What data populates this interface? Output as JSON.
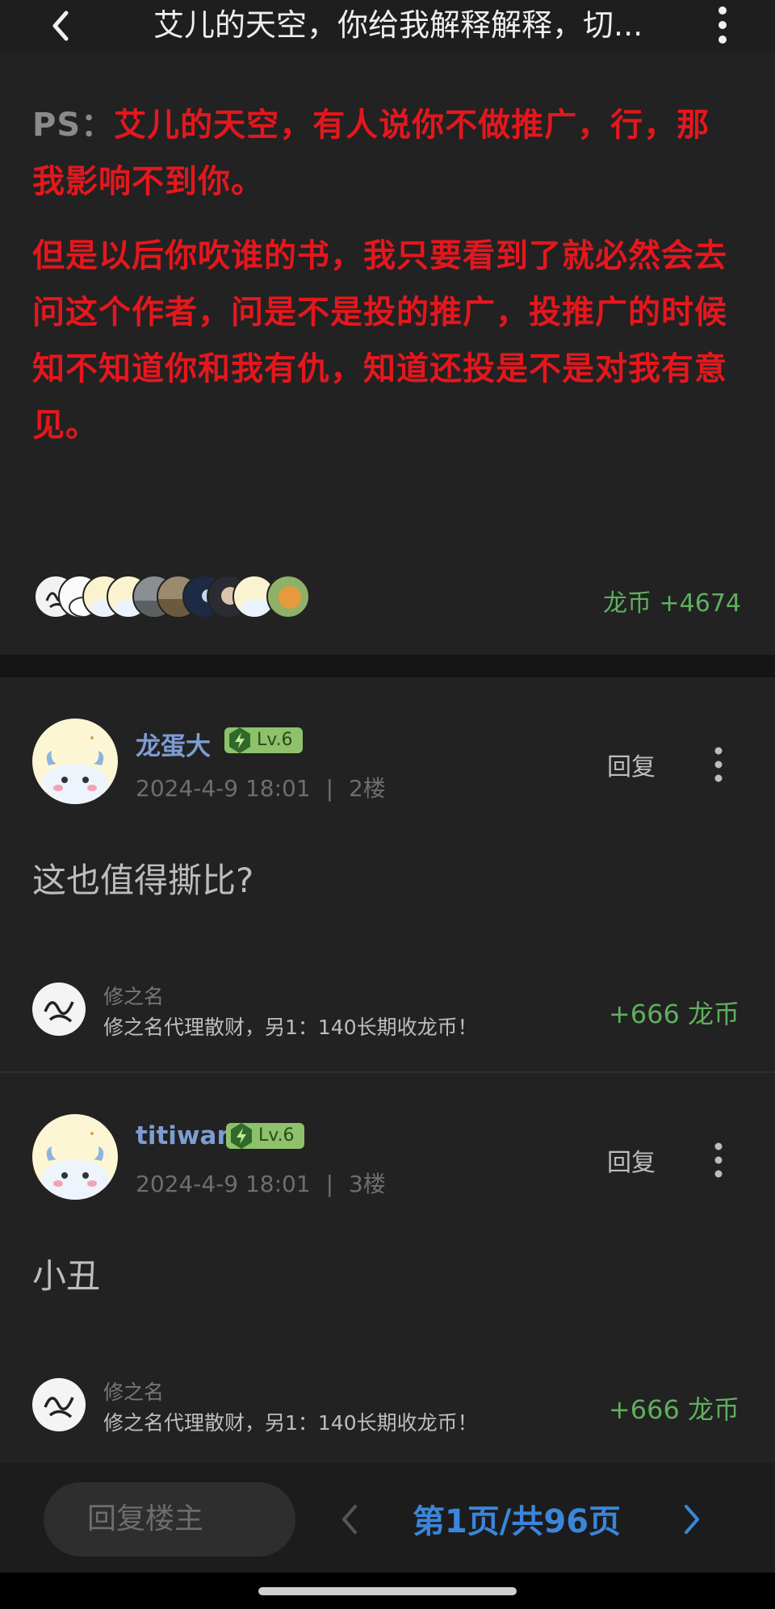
{
  "header": {
    "title": "艾儿的天空，你给我解释解释，切..."
  },
  "op": {
    "ps_label": "PS：",
    "ps_line": "艾儿的天空，有人说你不做推广，行，那我影响不到你。",
    "paragraph2": "但是以后你吹谁的书，我只要看到了就必然会去问这个作者，问是不是投的推广，投推广的时候知不知道你和我有仇，知道还投是不是对我有意见。",
    "coins": "龙币 +4674",
    "tipper_avatars": [
      "calligraphy-avatar",
      "dragon-avatar",
      "dragon-avatar",
      "dragon-avatar",
      "landscape-avatar",
      "landscape-avatar",
      "night-avatar",
      "portrait-avatar",
      "dragon-avatar",
      "orange-avatar"
    ]
  },
  "posts": [
    {
      "username": "龙蛋大",
      "level": "Lv.6",
      "time": "2024-4-9 18:01",
      "sep": "|",
      "floor": "2楼",
      "reply": "回复",
      "content": "这也值得撕比?",
      "tip": {
        "name": "修之名",
        "message": "修之名代理散财，另1：140长期收龙币！",
        "coins": "+666 龙币"
      }
    },
    {
      "username": "titiwan",
      "level": "Lv.6",
      "time": "2024-4-9 18:01",
      "sep": "|",
      "floor": "3楼",
      "reply": "回复",
      "content": "小丑",
      "tip": {
        "name": "修之名",
        "message": "修之名代理散财，另1：140长期收龙币！",
        "coins": "+666 龙币"
      }
    }
  ],
  "footer": {
    "reply_placeholder": "回复楼主",
    "page_indicator": "第1页/共96页"
  },
  "colors": {
    "background": "#1c1c1c",
    "card": "#222222",
    "red_text": "#e4171d",
    "username": "#7d9cd2",
    "coins_green": "#5fae5f",
    "level_badge": "#8ec26a",
    "page_blue": "#3a86d9"
  }
}
